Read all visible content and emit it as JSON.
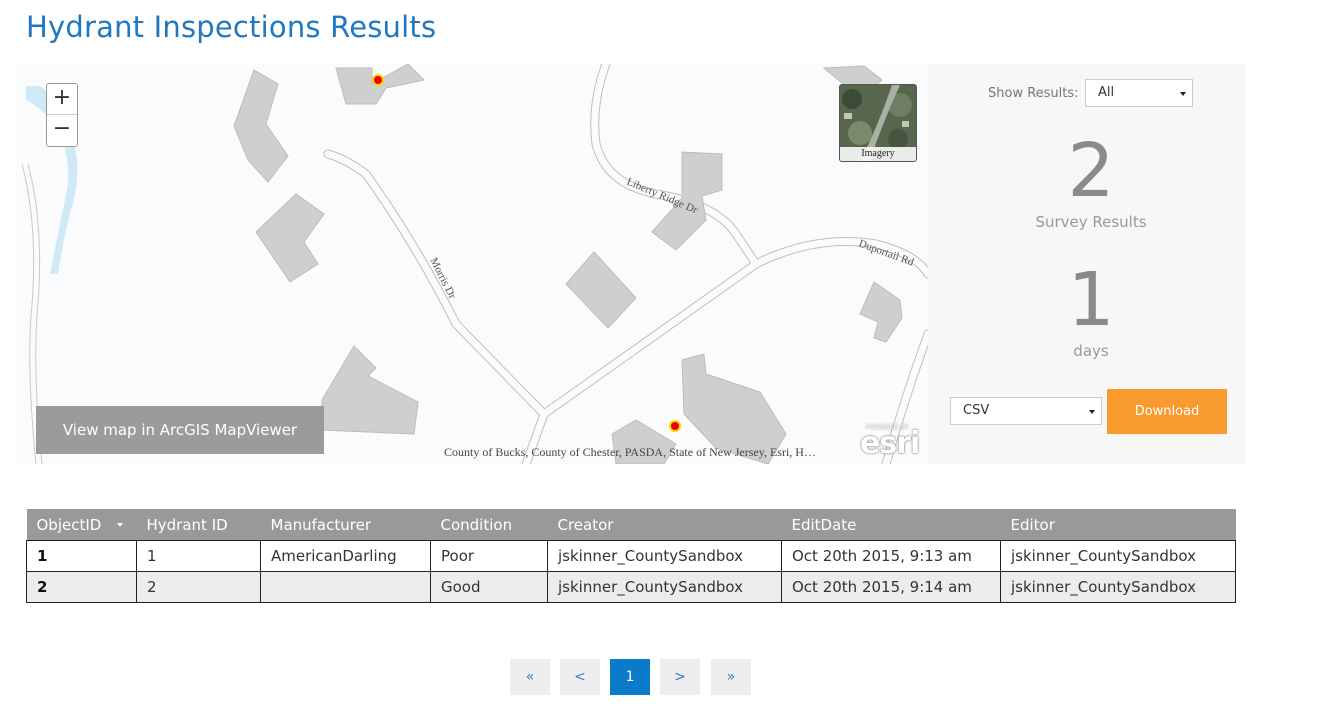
{
  "page": {
    "title": "Hydrant Inspections Results"
  },
  "map": {
    "zoom_in": "+",
    "zoom_out": "−",
    "basemap_label": "Imagery",
    "view_map_label": "View map in ArcGIS MapViewer",
    "attribution": "County of Bucks, County of Chester, PASDA, State of New Jersey, Esri, H…",
    "esri_powered": "POWERED BY",
    "esri_logo": "esri",
    "streets": [
      "Liberty Ridge Dr",
      "Morris Dr",
      "Duportail Rd"
    ],
    "marker_color": "#e60000",
    "marker_outline": "#ffd400"
  },
  "sidebar": {
    "filter_label": "Show Results:",
    "filter_value": "All",
    "count": "2",
    "count_label": "Survey Results",
    "days": "1",
    "days_label": "days",
    "format_value": "CSV",
    "download_label": "Download",
    "download_color": "#f89a2d"
  },
  "table": {
    "headers": [
      "ObjectID",
      "Hydrant ID",
      "Manufacturer",
      "Condition",
      "Creator",
      "EditDate",
      "Editor"
    ],
    "rows": [
      [
        "1",
        "1",
        "AmericanDarling",
        "Poor",
        "jskinner_CountySandbox",
        "Oct 20th 2015, 9:13 am",
        "jskinner_CountySandbox"
      ],
      [
        "2",
        "2",
        "",
        "Good",
        "jskinner_CountySandbox",
        "Oct 20th 2015, 9:14 am",
        "jskinner_CountySandbox"
      ]
    ]
  },
  "pagination": {
    "first": "«",
    "prev": "<",
    "current": "1",
    "next": ">",
    "last": "»",
    "active_color": "#0b7ac9"
  }
}
